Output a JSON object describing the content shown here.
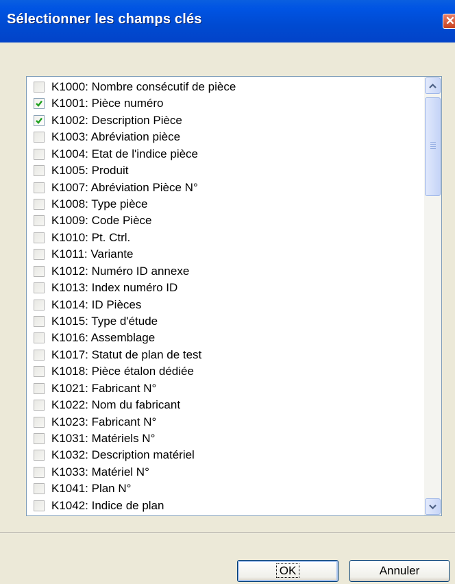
{
  "dialog": {
    "title": "Sélectionner les champs clés",
    "close_glyph": "✕",
    "ok_label": "OK",
    "cancel_label": "Annuler"
  },
  "list": {
    "items": [
      {
        "label": "K1000: Nombre consécutif de pièce",
        "checked": false
      },
      {
        "label": "K1001: Pièce numéro",
        "checked": true
      },
      {
        "label": "K1002: Description Pièce",
        "checked": true
      },
      {
        "label": "K1003: Abréviation pièce",
        "checked": false
      },
      {
        "label": "K1004: Etat de l'indice pièce",
        "checked": false
      },
      {
        "label": "K1005: Produit",
        "checked": false
      },
      {
        "label": "K1007: Abréviation Pièce N°",
        "checked": false
      },
      {
        "label": "K1008: Type pièce",
        "checked": false
      },
      {
        "label": "K1009: Code Pièce",
        "checked": false
      },
      {
        "label": "K1010: Pt. Ctrl.",
        "checked": false
      },
      {
        "label": "K1011: Variante",
        "checked": false
      },
      {
        "label": "K1012: Numéro ID annexe",
        "checked": false
      },
      {
        "label": "K1013: Index numéro ID",
        "checked": false
      },
      {
        "label": "K1014: ID Pièces",
        "checked": false
      },
      {
        "label": "K1015: Type d'étude",
        "checked": false
      },
      {
        "label": "K1016: Assemblage",
        "checked": false
      },
      {
        "label": "K1017: Statut de plan de test",
        "checked": false
      },
      {
        "label": "K1018: Pièce étalon dédiée",
        "checked": false
      },
      {
        "label": "K1021: Fabricant N°",
        "checked": false
      },
      {
        "label": "K1022: Nom du fabricant",
        "checked": false
      },
      {
        "label": "K1023: Fabricant N°",
        "checked": false
      },
      {
        "label": "K1031: Matériels N°",
        "checked": false
      },
      {
        "label": "K1032: Description matériel",
        "checked": false
      },
      {
        "label": "K1033: Matériel N°",
        "checked": false
      },
      {
        "label": "K1041: Plan N°",
        "checked": false
      },
      {
        "label": "K1042: Indice de plan",
        "checked": false
      }
    ]
  },
  "icons": {
    "scroll_up": "chevron-up-icon",
    "scroll_down": "chevron-down-icon",
    "check": "checkmark-icon"
  },
  "colors": {
    "title_bar": "#0054e3",
    "checkmark": "#21a121",
    "scrollbar": "#c7d5f7"
  }
}
